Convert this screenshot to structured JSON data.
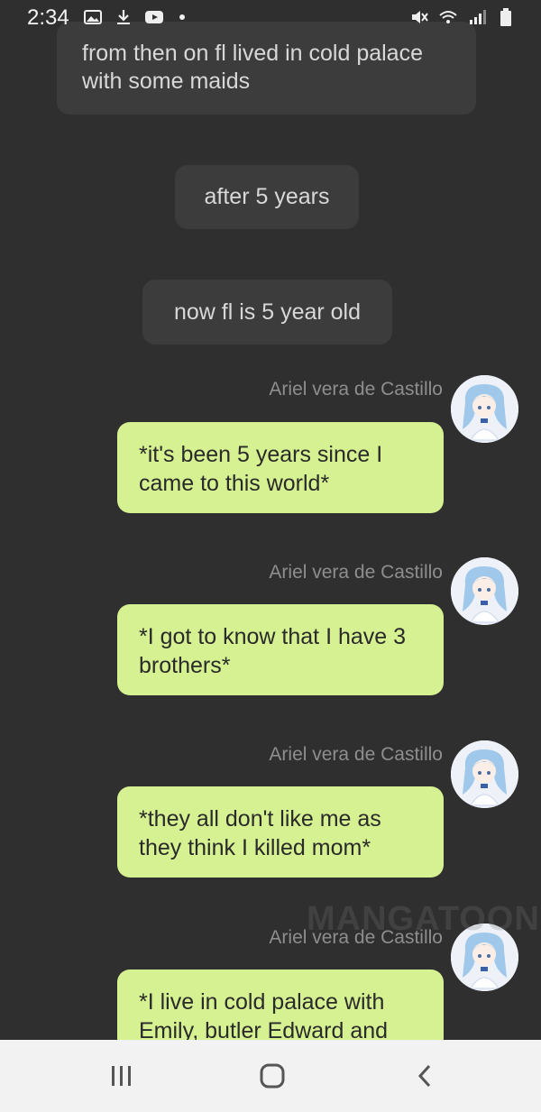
{
  "status_bar": {
    "time": "2:34",
    "left_icons": [
      "image-icon",
      "download-icon",
      "youtube-icon",
      "dot-icon"
    ],
    "right_icons": [
      "mute-icon",
      "wifi-icon",
      "signal-icon",
      "battery-icon"
    ]
  },
  "narrations": [
    "from then on fl lived in cold palace with some maids",
    "after 5 years",
    "now fl is 5 year old"
  ],
  "messages": [
    {
      "speaker": "Ariel vera de Castillo",
      "text": "*it's been 5 years since I came to this world*"
    },
    {
      "speaker": "Ariel vera de Castillo",
      "text": "*I got to know that I have 3 brothers*"
    },
    {
      "speaker": "Ariel vera de Castillo",
      "text": "*they all don't like me as they think I killed mom*"
    },
    {
      "speaker": "Ariel vera de Castillo",
      "text": "*I live in cold palace with Emily, butler Edward and"
    }
  ],
  "watermark": "MANGATOON",
  "nav": {
    "buttons": [
      "recents-icon",
      "home-icon",
      "back-icon"
    ]
  },
  "colors": {
    "background": "#2f2f2f",
    "bubble": "#d6f191",
    "narration": "#3c3c3c",
    "navbar": "#f2f2f2"
  }
}
